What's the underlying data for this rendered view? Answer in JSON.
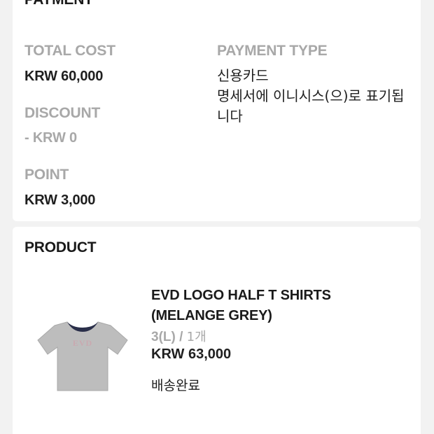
{
  "payment": {
    "title": "PAYMENT",
    "total_cost": {
      "label": "TOTAL COST",
      "value": "KRW 60,000"
    },
    "discount": {
      "label": "DISCOUNT",
      "value": "- KRW 0"
    },
    "point": {
      "label": "POINT",
      "value": "KRW 3,000"
    },
    "payment_type": {
      "label": "PAYMENT TYPE",
      "lines": [
        "신용카드",
        "명세서에 이니시스(으)로 표기됩",
        "니다"
      ]
    }
  },
  "product_section": {
    "title": "PRODUCT",
    "item": {
      "name": "EVD LOGO HALF T SHIRTS (MELANGE GREY)",
      "option": "3(L) / ",
      "quantity": "1개",
      "price": "KRW 63,000",
      "status": "배송완료",
      "image_icon": "grey-tshirt-thumbnail",
      "shirt_color": "#bdbdbd",
      "logo_color": "#c9a9b0"
    }
  }
}
